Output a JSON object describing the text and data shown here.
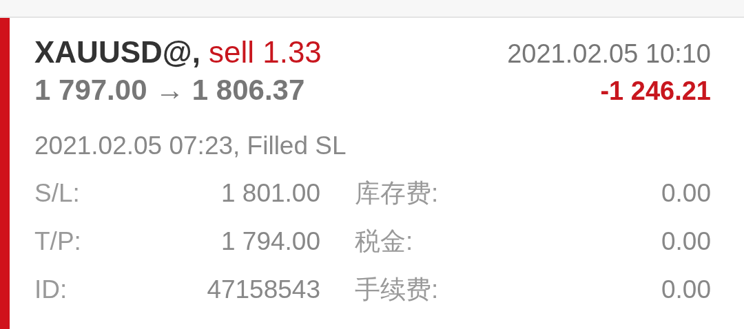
{
  "order": {
    "symbol": "XAUUSD@,",
    "trade": "sell 1.33",
    "time": "2021.02.05 10:10",
    "prices": "1 797.00 → 1 806.37",
    "profit": "-1 246.21",
    "filled": "2021.02.05 07:23, Filled SL",
    "details": [
      {
        "label": "S/L:",
        "value": "1 801.00"
      },
      {
        "label": "T/P:",
        "value": "1 794.00"
      },
      {
        "label": "ID:",
        "value": "47158543"
      }
    ],
    "fees": [
      {
        "label": "库存费:",
        "value": "0.00"
      },
      {
        "label": "税金:",
        "value": "0.00"
      },
      {
        "label": "手续费:",
        "value": "0.00"
      }
    ]
  }
}
